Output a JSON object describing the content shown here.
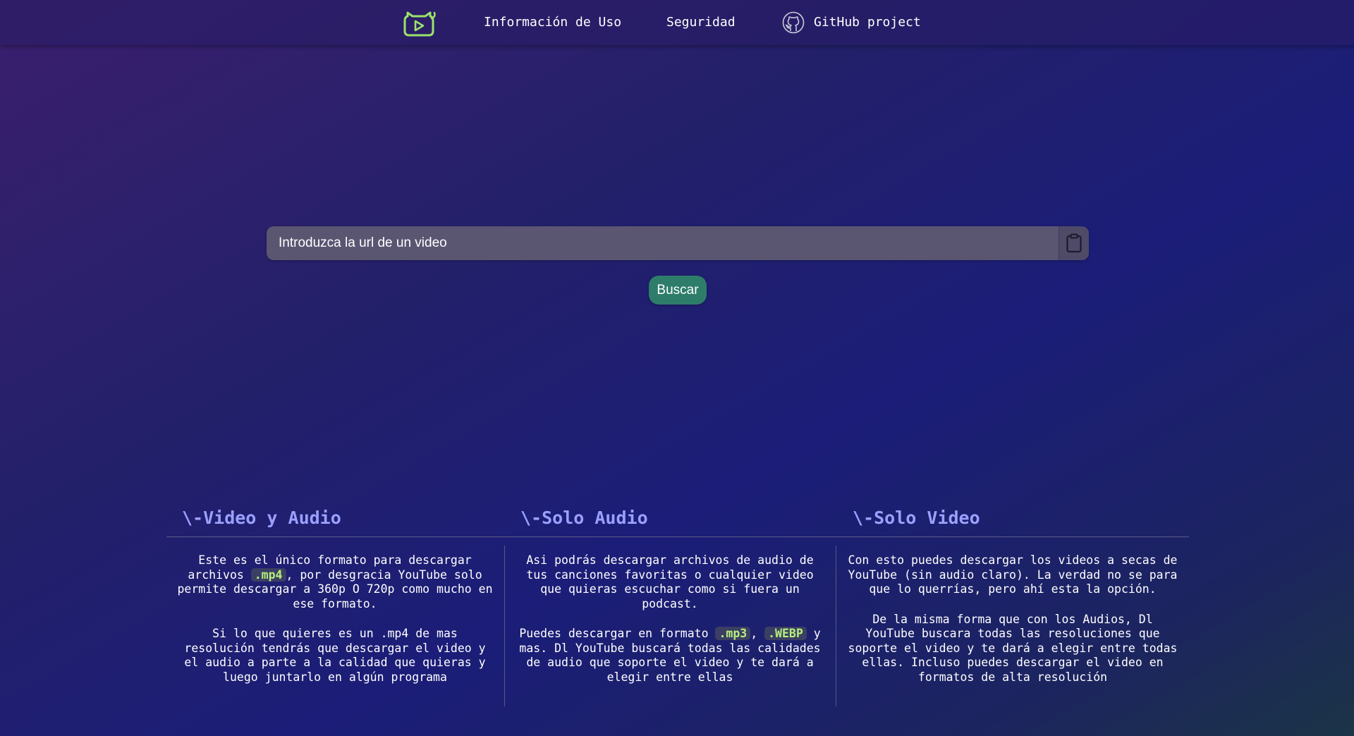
{
  "nav": {
    "logo_icon": "cat-play-logo-icon",
    "info_label": "Información de Uso",
    "security_label": "Seguridad",
    "github_icon": "github-icon",
    "github_label": "GitHub project"
  },
  "search": {
    "placeholder": "Introduzca la url de un video",
    "paste_icon": "clipboard-icon",
    "button_label": "Buscar"
  },
  "features": [
    {
      "title": "\\-Video y Audio",
      "p1_before": "Este es el único formato para descargar archivos ",
      "p1_code": ".mp4",
      "p1_after": ", por desgracia YouTube solo permite descargar a 360p O 720p como mucho en ese formato.",
      "p2": "Si lo que quieres es un .mp4 de mas resolución tendrás que descargar el video y el audio a parte a la calidad que quieras y luego juntarlo en algún programa"
    },
    {
      "title": "\\-Solo Audio",
      "p1": "Asi podrás descargar archivos de audio de tus canciones favoritas o cualquier video que quieras escuchar como si fuera un podcast.",
      "p2_before": "Puedes descargar en formato ",
      "p2_code1": ".mp3",
      "p2_mid": ", ",
      "p2_code2": ".WEBP",
      "p2_after": " y mas. Dl YouTube buscará todas las calidades de audio que soporte el video y te dará a elegir entre ellas"
    },
    {
      "title": "\\-Solo Video",
      "p1": "Con esto puedes descargar los videos a secas de YouTube (sin audio claro). La verdad no se para que lo querrías, pero ahí esta la opción.",
      "p2": "De la misma forma que con los Audios, Dl YouTube buscara todas las resoluciones que soporte el video y te dará a elegir entre todas ellas. Incluso puedes descargar el video en formatos de alta resolución"
    }
  ],
  "colors": {
    "accent_green": "#b6ef7c",
    "button_green": "#2e7d6b",
    "title_blue": "#9ba0ff"
  }
}
